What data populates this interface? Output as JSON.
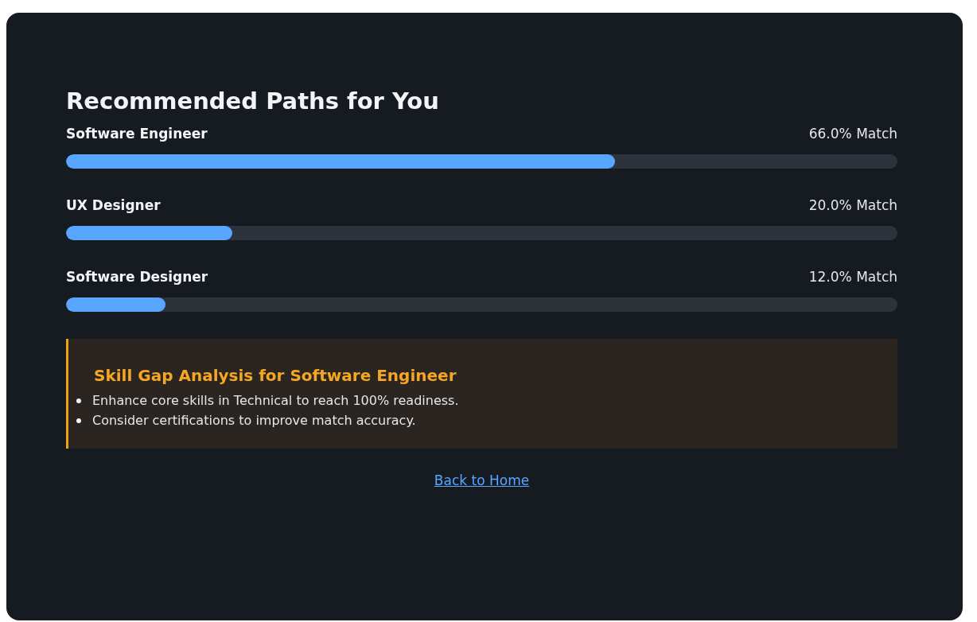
{
  "title": "Recommended Paths for You",
  "paths": [
    {
      "name": "Software Engineer",
      "reading": "66.0% Match",
      "level": 0.66
    },
    {
      "name": "UX Designer",
      "reading": "20.0% Match",
      "level": 0.2
    },
    {
      "name": "Software Designer",
      "reading": "12.0% Match",
      "level": 0.12
    }
  ],
  "gap_analysis": {
    "title": "Skill Gap Analysis for Software Engineer",
    "items": [
      "Enhance core skills in Technical to reach 100% readiness.",
      "Consider certifications to improve match accuracy."
    ]
  },
  "link": "Back to Home"
}
